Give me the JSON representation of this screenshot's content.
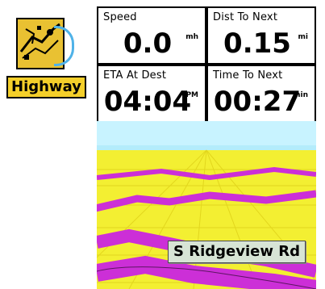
{
  "mode": {
    "label": "Highway",
    "icon": "highway-map-icon"
  },
  "fields": {
    "speed": {
      "label": "Speed",
      "value": "0.0",
      "unit": "mh"
    },
    "dist_to_next": {
      "label": "Dist To Next",
      "value": "0.15",
      "unit": "mi"
    },
    "eta_at_dest": {
      "label": "ETA At Dest",
      "value": "04:04",
      "unit": "PM"
    },
    "time_to_next": {
      "label": "Time To Next",
      "value": "00:27",
      "unit": "min"
    }
  },
  "map": {
    "road_label": "S Ridgeview Rd",
    "colors": {
      "sky": "#c8f3ff",
      "ground": "#f3ef32",
      "road": "#cc2fd7",
      "grid": "#e0d21a",
      "marker": "#000000"
    }
  }
}
